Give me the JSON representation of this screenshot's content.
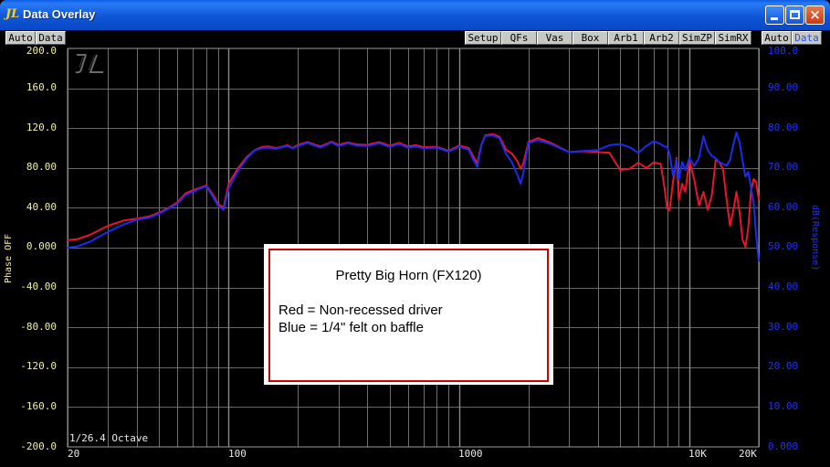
{
  "window": {
    "title": "Data Overlay",
    "buttons": {
      "minimize": "minimize",
      "maximize": "maximize",
      "close": "×"
    }
  },
  "toolbar": {
    "left": [
      "Auto",
      "Data"
    ],
    "middle": [
      "Setup",
      "QFs",
      "Vas",
      "Box",
      "Arb1",
      "Arb2",
      "SimZP",
      "SimRX"
    ],
    "right": [
      "Auto",
      "Data"
    ]
  },
  "colors": {
    "red_trace": "#e8142c",
    "blue_trace": "#1a2cf0",
    "grid": "#8a8a8a",
    "left_axis": "#f2f2a0",
    "right_axis": "#2233ee"
  },
  "chart_data": {
    "type": "line",
    "x_scale": "log",
    "xlim": [
      20,
      20000
    ],
    "x_ticks": [
      "20",
      "100",
      "1000",
      "10K",
      "20K"
    ],
    "y_left": {
      "label": "Phase OFF",
      "ylim": [
        -200,
        200
      ],
      "ticks": [
        "200.0",
        "160.0",
        "120.0",
        "80.00",
        "40.00",
        "0.000",
        "-40.00",
        "-80.00",
        "-120.0",
        "-160.0",
        "-200.0"
      ]
    },
    "y_right": {
      "label": "dB(Response)",
      "ylim": [
        0,
        100
      ],
      "ticks": [
        "100.0",
        "90.00",
        "80.00",
        "70.00",
        "60.00",
        "50.00",
        "40.00",
        "30.00",
        "20.00",
        "10.00",
        "0.000"
      ]
    },
    "resolution_label": "1/26.4 Octave",
    "grid": true,
    "annotation": {
      "title": "Pretty Big Horn (FX120)",
      "lines": [
        "Red = Non-recessed driver",
        "Blue = 1/4\" felt on baffle"
      ]
    },
    "series": [
      {
        "name": "Non-recessed driver",
        "color": "#e8142c",
        "x": [
          20,
          22,
          25,
          30,
          35,
          40,
          45,
          50,
          55,
          60,
          65,
          70,
          75,
          80,
          85,
          90,
          95,
          100,
          110,
          120,
          130,
          140,
          150,
          160,
          170,
          180,
          190,
          200,
          220,
          250,
          280,
          300,
          330,
          360,
          400,
          450,
          500,
          550,
          600,
          650,
          700,
          800,
          900,
          1000,
          1100,
          1150,
          1200,
          1250,
          1300,
          1400,
          1500,
          1600,
          1700,
          1800,
          1850,
          1900,
          2000,
          2200,
          2500,
          3000,
          3500,
          4000,
          4500,
          5000,
          5500,
          6000,
          6500,
          7000,
          7500,
          7800,
          8000,
          8200,
          8500,
          8800,
          9000,
          9300,
          9600,
          10000,
          10500,
          11000,
          11500,
          12000,
          12500,
          13000,
          13500,
          14000,
          14500,
          15000,
          15500,
          16000,
          16500,
          17000,
          17500,
          18000,
          18500,
          19000,
          19500,
          20000
        ],
        "y": [
          51.9,
          52.1,
          53.2,
          55.5,
          56.8,
          57.3,
          57.8,
          58.8,
          60.0,
          61.4,
          63.6,
          64.4,
          65.0,
          65.6,
          63.5,
          61.0,
          60.0,
          66.0,
          70.0,
          72.8,
          74.5,
          75.3,
          75.4,
          75.0,
          75.3,
          75.7,
          75.0,
          75.8,
          76.5,
          75.4,
          76.6,
          75.8,
          76.4,
          75.9,
          75.8,
          76.5,
          75.6,
          76.3,
          75.4,
          75.7,
          75.2,
          75.3,
          74.3,
          75.6,
          75.0,
          73.0,
          71.2,
          75.8,
          78.2,
          78.5,
          77.8,
          74.6,
          73.5,
          71.5,
          69.8,
          71.0,
          76.5,
          77.5,
          76.3,
          74.0,
          74.2,
          74.0,
          73.8,
          69.5,
          69.8,
          71.3,
          70.0,
          71.4,
          71.0,
          65.0,
          59.8,
          59.4,
          66.8,
          72.5,
          62.0,
          66.0,
          64.0,
          71.9,
          67.0,
          60.6,
          64.0,
          59.5,
          63.0,
          72.0,
          71.5,
          69.5,
          62.0,
          55.5,
          59.3,
          64.0,
          59.0,
          52.0,
          50.2,
          55.0,
          64.3,
          67.2,
          66.4,
          62.0
        ]
      },
      {
        "name": "1/4\" felt on baffle",
        "color": "#1a2cf0",
        "x": [
          20,
          22,
          25,
          30,
          35,
          40,
          45,
          50,
          55,
          60,
          65,
          70,
          75,
          80,
          85,
          90,
          95,
          100,
          110,
          120,
          130,
          140,
          150,
          160,
          170,
          180,
          190,
          200,
          220,
          250,
          280,
          300,
          330,
          360,
          400,
          450,
          500,
          550,
          600,
          650,
          700,
          800,
          900,
          1000,
          1100,
          1150,
          1200,
          1250,
          1300,
          1400,
          1500,
          1600,
          1700,
          1800,
          1850,
          1900,
          2000,
          2200,
          2500,
          3000,
          3500,
          4000,
          4500,
          5000,
          5500,
          6000,
          6500,
          7000,
          7500,
          7800,
          8000,
          8200,
          8500,
          8800,
          9000,
          9300,
          9600,
          10000,
          10500,
          11000,
          11500,
          12000,
          12500,
          13000,
          13500,
          14000,
          14500,
          15000,
          15500,
          16000,
          16500,
          17000,
          17500,
          18000,
          18500,
          19000,
          19500,
          20000
        ],
        "y": [
          50.0,
          50.3,
          51.5,
          54.0,
          55.8,
          57.0,
          57.5,
          58.5,
          59.8,
          61.0,
          63.2,
          64.0,
          64.8,
          65.4,
          63.0,
          60.5,
          59.5,
          64.8,
          69.3,
          72.4,
          74.4,
          75.0,
          75.1,
          74.8,
          75.2,
          75.5,
          74.9,
          75.5,
          76.3,
          75.1,
          76.4,
          75.5,
          76.2,
          75.6,
          75.5,
          76.2,
          75.3,
          76.0,
          75.1,
          75.4,
          74.9,
          75.1,
          74.1,
          75.3,
          74.6,
          72.2,
          70.3,
          75.7,
          78.0,
          78.2,
          77.4,
          73.5,
          71.3,
          68.0,
          66.0,
          68.5,
          76.2,
          77.0,
          76.0,
          74.0,
          74.3,
          74.5,
          75.7,
          76.0,
          75.2,
          73.8,
          75.5,
          76.7,
          76.0,
          75.4,
          75.3,
          73.5,
          68.0,
          72.0,
          67.0,
          71.5,
          69.5,
          72.5,
          70.5,
          72.5,
          78.0,
          74.5,
          73.0,
          72.4,
          71.5,
          71.0,
          70.6,
          72.0,
          75.8,
          78.9,
          76.5,
          71.8,
          67.8,
          69.0,
          65.0,
          61.3,
          53.0,
          46.5
        ]
      }
    ]
  }
}
